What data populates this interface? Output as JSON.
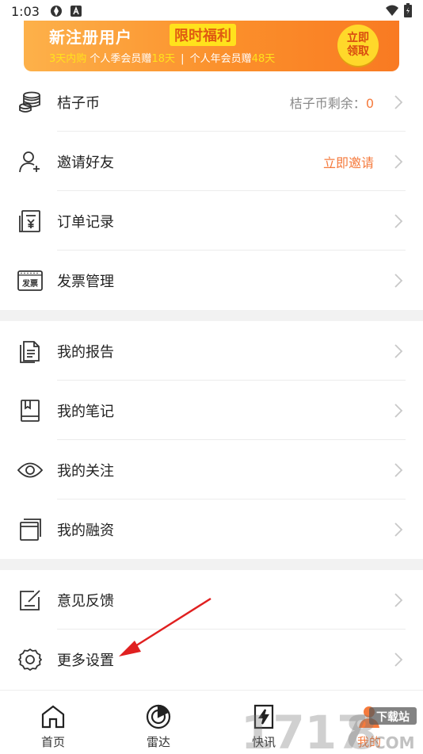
{
  "status_bar": {
    "time": "1:03"
  },
  "banner": {
    "title": "新注册用户",
    "tag": "限时福利",
    "sub_p1": "3天内购",
    "sub_p2": "个人季会员赠",
    "sub_p3": "18天",
    "sub_sep": "|",
    "sub_p4": "个人年会员赠",
    "sub_p5": "48天",
    "button_line1": "立即",
    "button_line2": "领取"
  },
  "menu": {
    "coins": {
      "label": "桔子币",
      "right_label": "桔子币剩余：",
      "right_value": "0"
    },
    "invite": {
      "label": "邀请好友",
      "right_label": "立即邀请"
    },
    "orders": {
      "label": "订单记录"
    },
    "invoice": {
      "label": "发票管理",
      "icon_text": "发票"
    },
    "reports": {
      "label": "我的报告"
    },
    "notes": {
      "label": "我的笔记"
    },
    "follows": {
      "label": "我的关注"
    },
    "financing": {
      "label": "我的融资"
    },
    "feedback": {
      "label": "意见反馈"
    },
    "settings": {
      "label": "更多设置"
    }
  },
  "tabbar": {
    "home": "首页",
    "radar": "雷达",
    "news": "快讯",
    "mine": "我的"
  },
  "watermark": {
    "text_a": "1717",
    "text_b": "8",
    "text_c": "COM",
    "badge": "下载站"
  },
  "colors": {
    "accent_orange": "#f57a3c",
    "banner_yellow": "#ffe21c",
    "divider_gray": "#f2f2f2"
  }
}
